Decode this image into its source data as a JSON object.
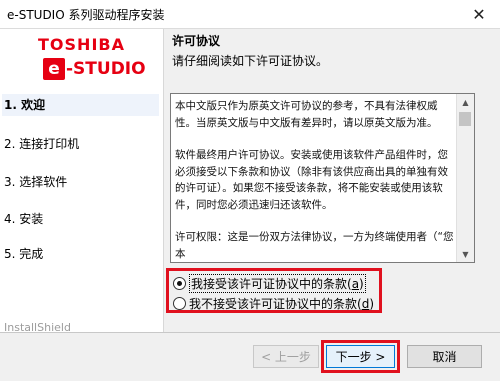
{
  "window": {
    "title": "e-STUDIO 系列驱动程序安装",
    "close_symbol": "✕"
  },
  "logo": {
    "brand": "TOSHIBA",
    "product_e": "e",
    "product_rest": "-STUDIO"
  },
  "steps": [
    {
      "label": "1. 欢迎",
      "active": true
    },
    {
      "label": "2. 连接打印机",
      "active": false
    },
    {
      "label": "3. 选择软件",
      "active": false
    },
    {
      "label": "4. 安装",
      "active": false
    },
    {
      "label": "5. 完成",
      "active": false
    }
  ],
  "installshield": "InstallShield",
  "header": {
    "title": "许可协议",
    "subtitle": "请仔细阅读如下许可证协议。"
  },
  "license": {
    "paragraphs": [
      "本中文版只作为原英文许可协议的参考，不具有法律权威性。当原英文版与中文版有差异时，请以原英文版为准。",
      "软件最终用户许可协议。安装或使用该软件产品组件时，您必须接受以下条款和协议（除非有该供应商出具的单独有效的许可证）。如果您不接受该条款，将不能安装或使用该软件，同时您必须迅速归还该软件。",
      "许可权限：这是一份双方法律协议，一方为终端使用者（“您本"
    ]
  },
  "radio": {
    "accept_label": "我接受该许可证协议中的条款(",
    "accept_key": "a",
    "accept_close": ")",
    "reject_label": "我不接受该许可证协议中的条款(",
    "reject_key": "d",
    "reject_close": ")",
    "selected": "accept"
  },
  "buttons": {
    "back": "< 上一步",
    "next": "下一步 >",
    "cancel": "取消"
  },
  "colors": {
    "brand_red": "#e60012",
    "highlight_red": "#e0101e",
    "focus_blue": "#0078d7"
  },
  "icons": {
    "close": "close-icon",
    "scroll_up": "chevron-up-icon",
    "scroll_down": "chevron-down-icon"
  }
}
